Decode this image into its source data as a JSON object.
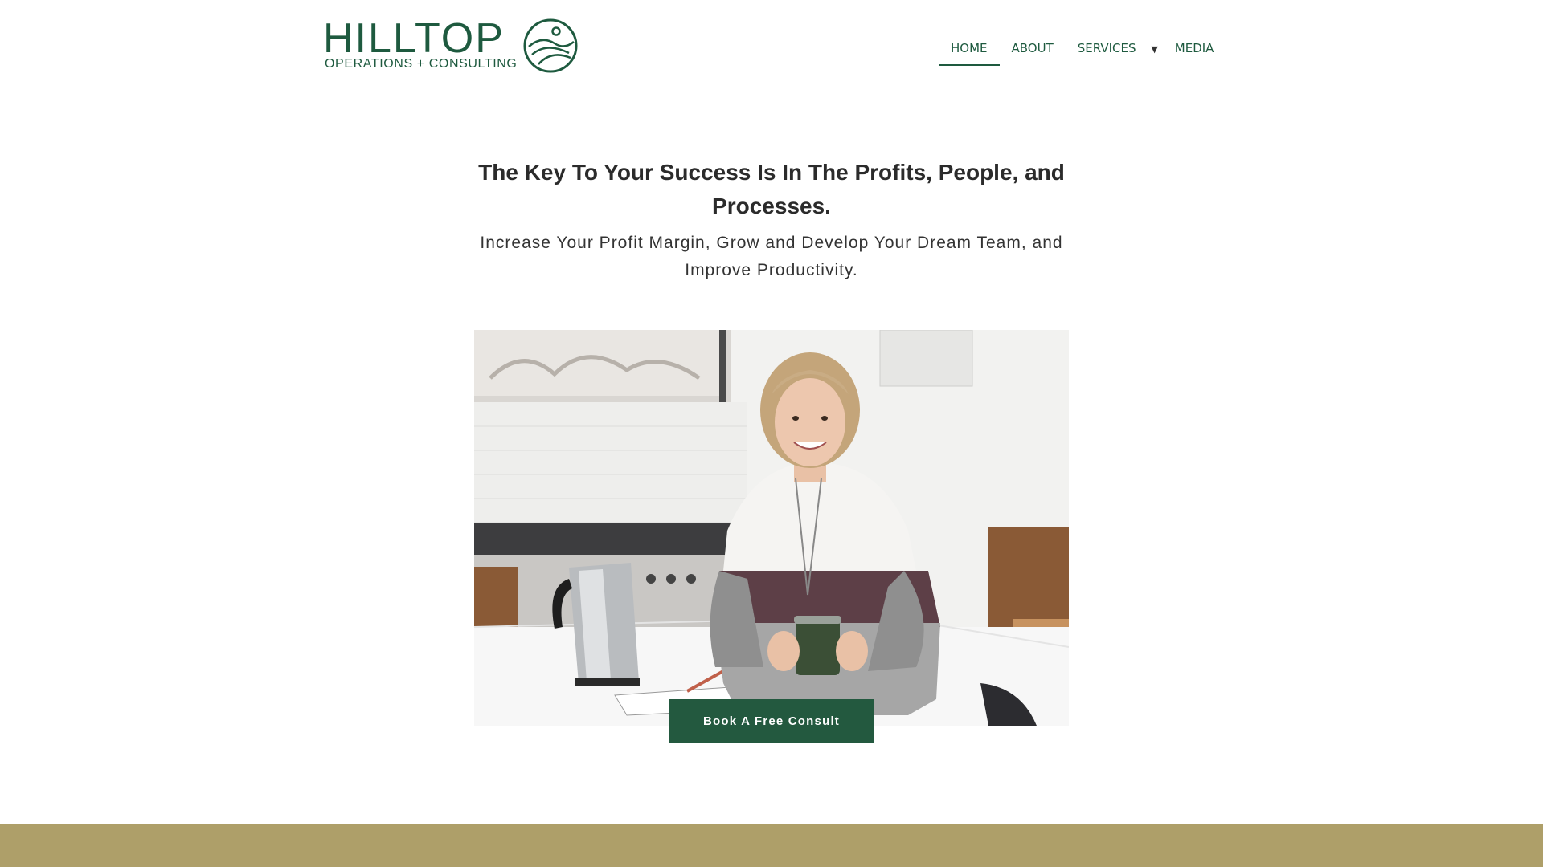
{
  "brand": {
    "name": "HILLTOP",
    "tagline": "OPERATIONS + CONSULTING",
    "color": "#1e5a3f"
  },
  "nav": {
    "items": [
      {
        "label": "HOME",
        "active": true
      },
      {
        "label": "ABOUT",
        "active": false
      },
      {
        "label": "SERVICES",
        "active": false,
        "has_dropdown": true,
        "dropdown_icon": "caret-down-icon"
      },
      {
        "label": "MEDIA",
        "active": false
      }
    ],
    "caret": "▼"
  },
  "hero": {
    "title": "The Key To Your Success Is In The Profits, People, and Processes.",
    "subtitle": "Increase Your Profit Margin, Grow and Develop Your Dream Team, and Improve Productivity.",
    "image_alt": "Woman smiling at a kitchen counter holding a green mug, with a kettle and notebook"
  },
  "cta": {
    "label": "Book A Free Consult",
    "color": "#23593f"
  },
  "colors": {
    "band": "#ae9f69",
    "text_dark": "#2b2b2b"
  }
}
